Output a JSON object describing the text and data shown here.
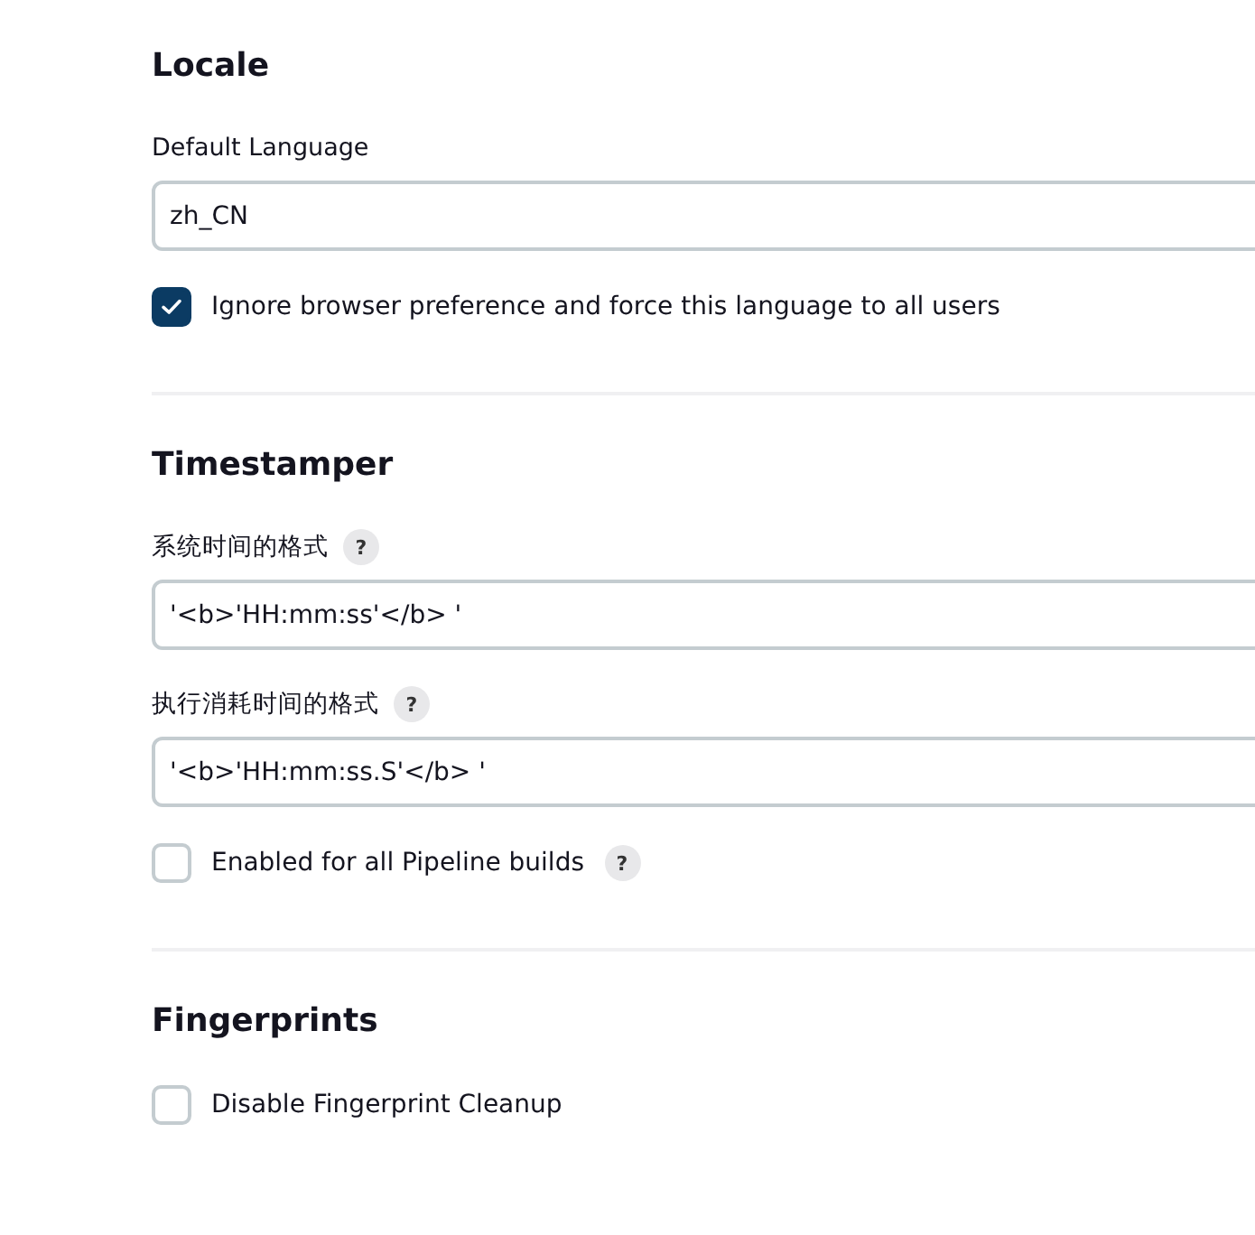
{
  "sections": [
    {
      "title": "Locale",
      "items": [
        {
          "kind": "field",
          "label": "Default Language",
          "value": "zh_CN"
        },
        {
          "kind": "checkbox",
          "label": "Ignore browser preference and force this language to all users",
          "checked": true
        }
      ]
    },
    {
      "title": "Timestamper",
      "items": [
        {
          "kind": "field",
          "label": "系统时间的格式",
          "help": "?",
          "value": "'<b>'HH:mm:ss'</b> '"
        },
        {
          "kind": "field",
          "label": "执行消耗时间的格式",
          "help": "?",
          "value": "'<b>'HH:mm:ss.S'</b> '"
        },
        {
          "kind": "checkbox",
          "label": "Enabled for all Pipeline builds",
          "help": "?",
          "checked": false
        }
      ]
    },
    {
      "title": "Fingerprints",
      "items": [
        {
          "kind": "checkbox",
          "label": "Disable Fingerprint Cleanup",
          "checked": false
        }
      ]
    }
  ]
}
